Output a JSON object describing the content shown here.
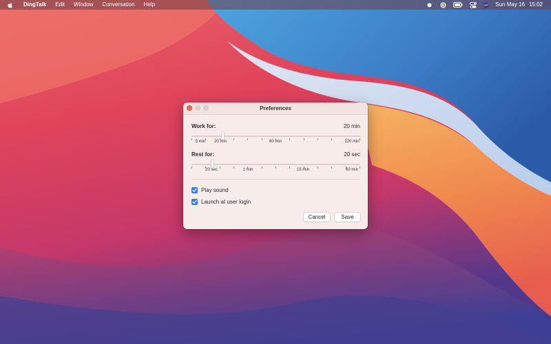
{
  "menubar": {
    "apple_icon": "apple-icon",
    "app_name": "DingTalk",
    "menus": [
      "Edit",
      "Window",
      "Conversation",
      "Help"
    ],
    "status_icons": [
      "record-dot-icon",
      "clock-badge-icon",
      "battery-icon",
      "control-center-icon",
      "siri-icon"
    ],
    "date": "Sun May 16",
    "time": "15:02"
  },
  "window": {
    "title": "Preferences",
    "work": {
      "label": "Work for:",
      "value": "20 min",
      "ticks": [
        "5 min",
        "20 min",
        "60 min",
        "120 min"
      ],
      "position": 0.18
    },
    "rest": {
      "label": "Rest for:",
      "value": "20 sec",
      "ticks": [
        "20 sec",
        "1 min",
        "15 min",
        "60 min"
      ],
      "position": 0.12
    },
    "options": [
      {
        "label": "Play sound",
        "checked": true
      },
      {
        "label": "Launch at user login",
        "checked": true
      }
    ],
    "buttons": {
      "cancel": "Cancel",
      "save": "Save"
    }
  },
  "colors": {
    "accent": "#2f7ff0",
    "close": "#ee6b60",
    "window_bg": "#f8ecea"
  }
}
